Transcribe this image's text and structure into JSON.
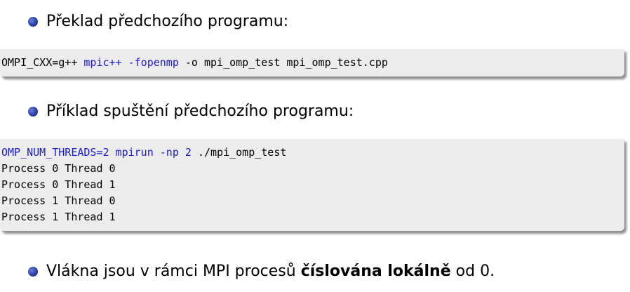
{
  "bullet1": "Překlad předchozího programu:",
  "code1": {
    "lines": [
      [
        {
          "text": "OMPI_CXX=g++ ",
          "style": "plain"
        },
        {
          "text": "mpic++ -fopenmp",
          "style": "kw"
        },
        {
          "text": " -o mpi_omp_test mpi_omp_test.cpp",
          "style": "plain"
        }
      ]
    ]
  },
  "bullet2": "Příklad spuštění předchozího programu:",
  "code2": {
    "lines": [
      [
        {
          "text": "OMP_NUM_THREADS=2 mpirun -np 2",
          "style": "kw"
        },
        {
          "text": " ./mpi_omp_test",
          "style": "plain"
        }
      ],
      [
        {
          "text": "Process 0 Thread 0",
          "style": "plain"
        }
      ],
      [
        {
          "text": "Process 0 Thread 1",
          "style": "plain"
        }
      ],
      [
        {
          "text": "Process 1 Thread 0",
          "style": "plain"
        }
      ],
      [
        {
          "text": "Process 1 Thread 1",
          "style": "plain"
        }
      ]
    ]
  },
  "bullet3": {
    "before": "Vlákna jsou v rámci MPI procesů ",
    "bold": "číslována lokálně",
    "after": " od 0."
  },
  "colors": {
    "keyword": "#1a1ad6",
    "code_background": "#ececec",
    "bullet": "#2b3fa8"
  }
}
